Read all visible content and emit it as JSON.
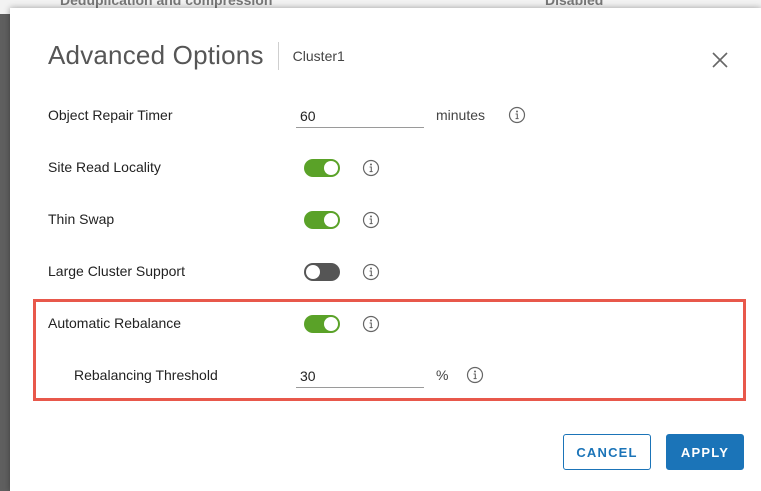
{
  "background": {
    "partial_text_left": "Deduplication and compression",
    "partial_text_right": "Disabled"
  },
  "dialog": {
    "title": "Advanced Options",
    "subtitle": "Cluster1",
    "close_icon": "close-icon"
  },
  "settings": {
    "object_repair_timer": {
      "label": "Object Repair Timer",
      "value": "60",
      "unit": "minutes"
    },
    "site_read_locality": {
      "label": "Site Read Locality",
      "enabled": true
    },
    "thin_swap": {
      "label": "Thin Swap",
      "enabled": true
    },
    "large_cluster_support": {
      "label": "Large Cluster Support",
      "enabled": false
    },
    "automatic_rebalance": {
      "label": "Automatic Rebalance",
      "enabled": true
    },
    "rebalancing_threshold": {
      "label": "Rebalancing Threshold",
      "value": "30",
      "unit": "%"
    }
  },
  "icons": {
    "info": "info-icon",
    "close": "close-icon"
  },
  "buttons": {
    "cancel": "CANCEL",
    "apply": "APPLY"
  },
  "colors": {
    "toggle_on": "#5aa228",
    "toggle_off": "#555555",
    "primary": "#1b74b8",
    "highlight": "#e8584b"
  }
}
